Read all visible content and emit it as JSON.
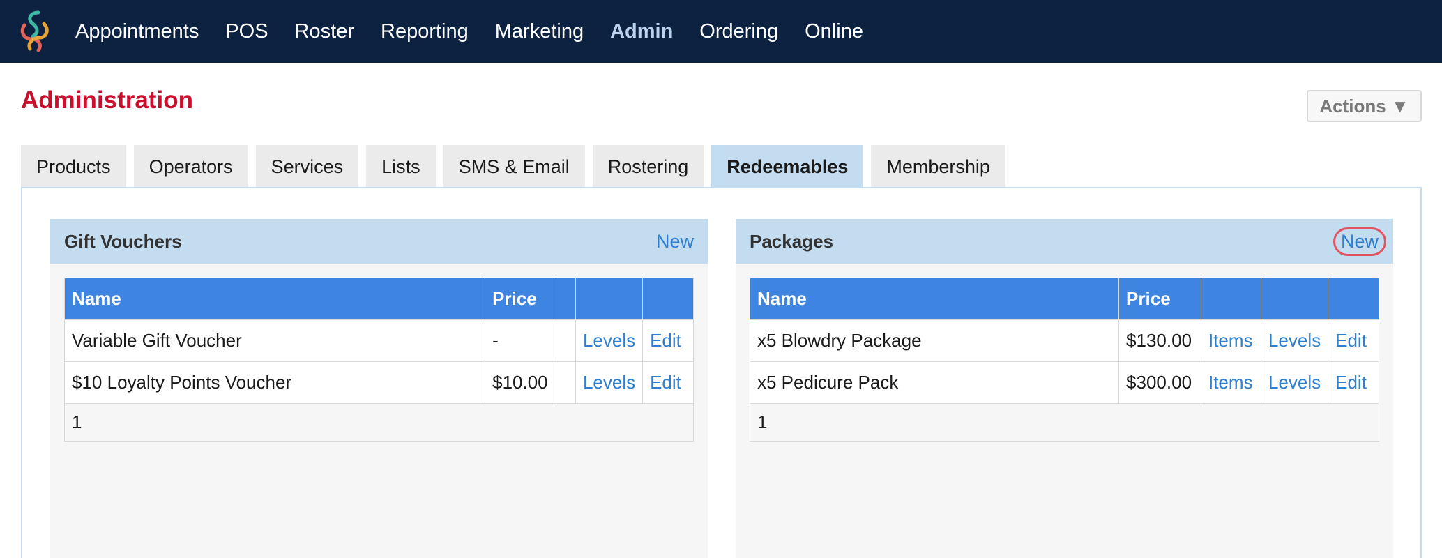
{
  "nav": {
    "items": [
      "Appointments",
      "POS",
      "Roster",
      "Reporting",
      "Marketing",
      "Admin",
      "Ordering",
      "Online"
    ],
    "active": "Admin"
  },
  "page": {
    "title": "Administration",
    "actions_label": "Actions ▼"
  },
  "tabs": {
    "items": [
      "Products",
      "Operators",
      "Services",
      "Lists",
      "SMS & Email",
      "Rostering",
      "Redeemables",
      "Membership"
    ],
    "active": "Redeemables"
  },
  "gift_vouchers": {
    "title": "Gift Vouchers",
    "new_label": "New",
    "columns": [
      "Name",
      "Price",
      "",
      "",
      ""
    ],
    "rows": [
      {
        "name": "Variable Gift Voucher",
        "price": "-",
        "levels": "Levels",
        "edit": "Edit"
      },
      {
        "name": "$10 Loyalty Points Voucher",
        "price": "$10.00",
        "levels": "Levels",
        "edit": "Edit"
      }
    ],
    "page": "1"
  },
  "packages": {
    "title": "Packages",
    "new_label": "New",
    "columns": [
      "Name",
      "Price",
      "",
      "",
      ""
    ],
    "rows": [
      {
        "name": "x5 Blowdry Package",
        "price": "$130.00",
        "items": "Items",
        "levels": "Levels",
        "edit": "Edit"
      },
      {
        "name": "x5 Pedicure Pack",
        "price": "$300.00",
        "items": "Items",
        "levels": "Levels",
        "edit": "Edit"
      }
    ],
    "page": "1"
  },
  "colors": {
    "nav_bg": "#0d2240",
    "title_red": "#c8102e",
    "link_blue": "#2f7fd1",
    "table_header": "#3d85e0",
    "panel_header": "#c4dcef",
    "highlight_ring": "#e05560"
  },
  "icons": {
    "logo": "swirl-logo-icon",
    "dropdown": "triangle-down-icon"
  }
}
